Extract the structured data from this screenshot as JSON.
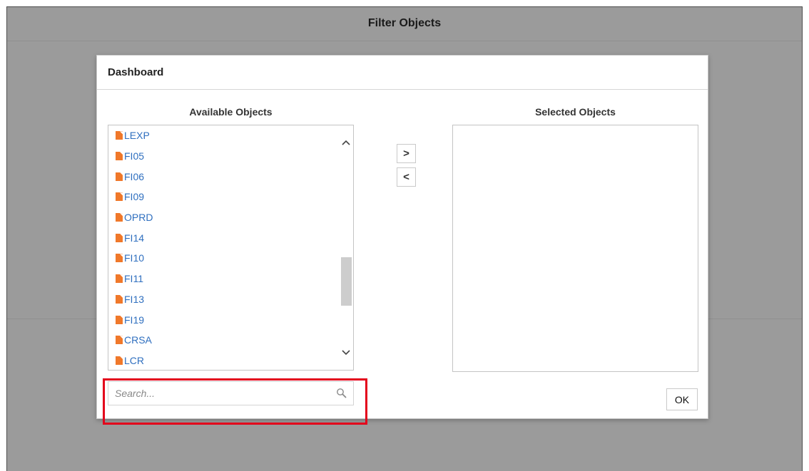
{
  "page": {
    "title": "Filter Objects"
  },
  "dialog": {
    "title": "Dashboard",
    "available": {
      "title": "Available Objects",
      "items": [
        "LEXP",
        "FI05",
        "FI06",
        "FI09",
        "OPRD",
        "FI14",
        "FI10",
        "FI11",
        "FI13",
        "FI19",
        "CRSA",
        "LCR"
      ]
    },
    "selected": {
      "title": "Selected Objects",
      "items": []
    },
    "buttons": {
      "add_label": ">",
      "remove_label": "<",
      "ok_label": "OK"
    },
    "search": {
      "placeholder": "Search...",
      "value": ""
    }
  },
  "colors": {
    "link": "#2f6fbf",
    "file_icon": "#f0782a",
    "highlight": "#e3001b",
    "backdrop": "#9b9b9b"
  },
  "icons": {
    "item": "file-icon",
    "search": "search-icon",
    "scroll_up": "chevron-up-icon",
    "scroll_down": "chevron-down-icon"
  }
}
